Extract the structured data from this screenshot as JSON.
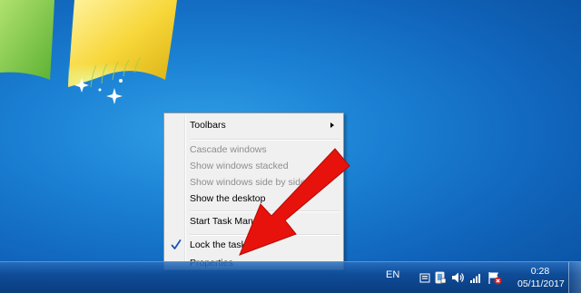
{
  "desktop": {
    "logo_icon": "windows-flag-logo"
  },
  "context_menu": {
    "items": [
      {
        "label": "Toolbars",
        "enabled": true,
        "has_submenu": true
      },
      {
        "label": "Cascade windows",
        "enabled": false
      },
      {
        "label": "Show windows stacked",
        "enabled": false
      },
      {
        "label": "Show windows side by side",
        "enabled": false
      },
      {
        "label": "Show the desktop",
        "enabled": true
      },
      {
        "label": "Start Task Manager",
        "enabled": true
      },
      {
        "label": "Lock the taskbar",
        "enabled": true,
        "checked": true
      },
      {
        "label": "Properties",
        "enabled": true
      }
    ]
  },
  "annotation": {
    "arrow_color": "#e8120c",
    "points_to": "Properties"
  },
  "taskbar": {
    "language": "EN",
    "tray_icons": [
      "action-center-icon",
      "show-hidden-icons-icon",
      "volume-icon",
      "network-signal-icon",
      "network-error-icon"
    ],
    "clock": {
      "time": "0:28",
      "date": "05/11/2017"
    }
  }
}
